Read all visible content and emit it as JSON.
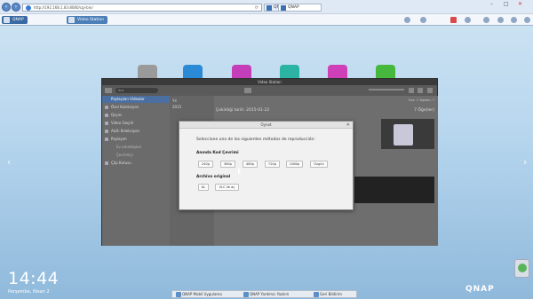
{
  "browser": {
    "address": "http://192.168.1.83:8080/cgi-bin/",
    "tabs": [
      {
        "label": "QNAP"
      },
      {
        "label": "QNAP"
      }
    ],
    "qnap_tabs": [
      {
        "label": "QNAP"
      },
      {
        "label": "Video Station"
      }
    ],
    "tray_badge": "1"
  },
  "window": {
    "title": "Video Station",
    "search_placeholder": "Ara",
    "sort_label": "Sıra: 1  Toplam: 7",
    "sidebar_header": "Paylaşılan Videolar",
    "sidebar_items": [
      {
        "label": "Özel Koleksiyon"
      },
      {
        "label": "Qsync"
      },
      {
        "label": "Video Geçidi"
      },
      {
        "label": "Akıllı Koleksiyon"
      },
      {
        "label": "Paylaşım"
      }
    ],
    "sidebar_subitems": [
      {
        "label": "Ev arkadaşları"
      },
      {
        "label": "Çevrimiçi"
      }
    ],
    "sidebar_trash": "Çöp Kutusu",
    "timeline_label": "Yıl",
    "timeline_year": "2015",
    "date_heading": "Çekildiği tarih: 2015-01-22",
    "item_count": "7 Öğe(ler)"
  },
  "modal": {
    "title": "Oynat",
    "prompt": "Seleccione uno de los siguientes métodos de reproducción:",
    "section_transcode": "Anında Kod Çevrimi",
    "resolutions": [
      "240p",
      "360p",
      "480p",
      "720p",
      "1080p",
      "Özgün"
    ],
    "section_original": "Archivo original",
    "original_buttons": [
      "AL",
      "VLC ile aç"
    ]
  },
  "desktop": {
    "time": "14:44",
    "date": "Perşembe, Nisan 2",
    "taskbar_items": [
      {
        "label": "QNAP Mobil Uygulama"
      },
      {
        "label": "QNAP Yardımcı Yazılım"
      },
      {
        "label": "Geri Bildirim"
      }
    ],
    "brand": "QNAP"
  },
  "colors": {
    "accent": "#4a6fa0",
    "window_bg": "#4d4d4d",
    "modal_bg": "#f1f1f1"
  }
}
